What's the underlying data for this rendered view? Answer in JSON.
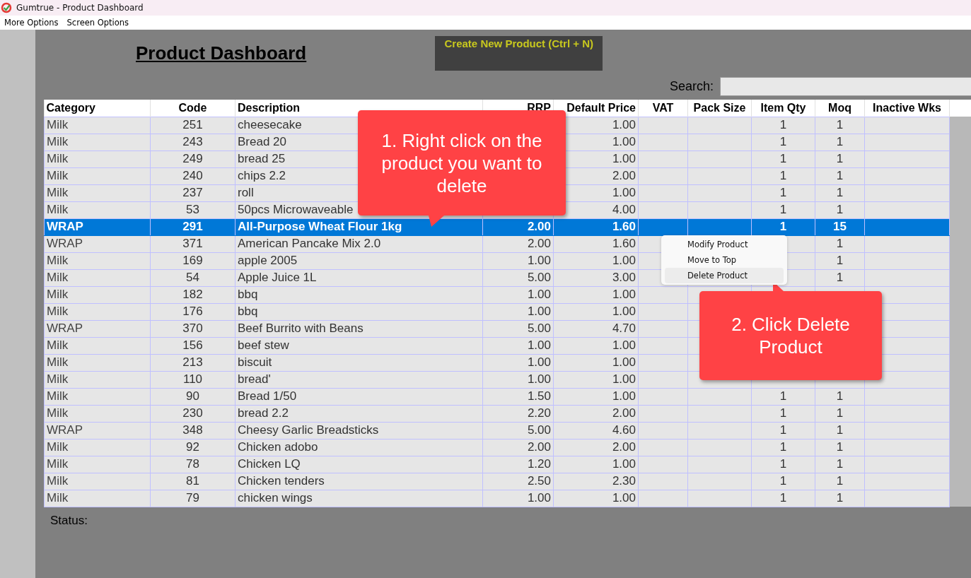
{
  "window": {
    "title": "Gumtrue - Product Dashboard"
  },
  "menu": [
    "More Options",
    "Screen Options"
  ],
  "heading": "Product Dashboard",
  "create_button": "Create New Product (Ctrl + N)",
  "search": {
    "label": "Search:"
  },
  "table": {
    "columns": [
      "Category",
      "Code",
      "Description",
      "RRP",
      "Default Price",
      "VAT",
      "Pack Size",
      "Item Qty",
      "Moq",
      "Inactive Wks"
    ],
    "rows": [
      {
        "category": "Milk",
        "code": "251",
        "description": "cheesecake",
        "default_price": "1.00",
        "item_qty": "1",
        "moq": "1",
        "selected": false
      },
      {
        "category": "Milk",
        "code": "243",
        "description": "Bread 20",
        "default_price": "1.00",
        "item_qty": "1",
        "moq": "1",
        "selected": false
      },
      {
        "category": "Milk",
        "code": "249",
        "description": "bread 25",
        "default_price": "1.00",
        "item_qty": "1",
        "moq": "1",
        "selected": false
      },
      {
        "category": "Milk",
        "code": "240",
        "description": "chips 2.2",
        "default_price": "2.00",
        "item_qty": "1",
        "moq": "1",
        "selected": false
      },
      {
        "category": "Milk",
        "code": "237",
        "description": "roll",
        "default_price": "1.00",
        "item_qty": "1",
        "moq": "1",
        "selected": false
      },
      {
        "category": "Milk",
        "code": "53",
        "description": "50pcs Microwaveable",
        "default_price": "4.00",
        "item_qty": "1",
        "moq": "1",
        "selected": false
      },
      {
        "category": "WRAP",
        "code": "291",
        "description": "All-Purpose Wheat Flour 1kg",
        "rrp": "2.00",
        "default_price": "1.60",
        "item_qty": "1",
        "moq": "15",
        "selected": true
      },
      {
        "category": "WRAP",
        "code": "371",
        "description": "American Pancake Mix 2.0",
        "rrp": "2.00",
        "default_price": "1.60",
        "moq": "1",
        "selected": false
      },
      {
        "category": "Milk",
        "code": "169",
        "description": "apple 2005",
        "rrp": "1.00",
        "default_price": "1.00",
        "moq": "1",
        "selected": false
      },
      {
        "category": "Milk",
        "code": "54",
        "description": "Apple Juice 1L",
        "rrp": "5.00",
        "default_price": "3.00",
        "moq": "1",
        "selected": false
      },
      {
        "category": "Milk",
        "code": "182",
        "description": "bbq",
        "rrp": "1.00",
        "default_price": "1.00",
        "selected": false
      },
      {
        "category": "Milk",
        "code": "176",
        "description": "bbq",
        "rrp": "1.00",
        "default_price": "1.00",
        "selected": false
      },
      {
        "category": "WRAP",
        "code": "370",
        "description": "Beef Burrito with Beans",
        "rrp": "5.00",
        "default_price": "4.70",
        "selected": false
      },
      {
        "category": "Milk",
        "code": "156",
        "description": "beef stew",
        "rrp": "1.00",
        "default_price": "1.00",
        "selected": false
      },
      {
        "category": "Milk",
        "code": "213",
        "description": "biscuit",
        "rrp": "1.00",
        "default_price": "1.00",
        "selected": false
      },
      {
        "category": "Milk",
        "code": "110",
        "description": "bread'",
        "rrp": "1.00",
        "default_price": "1.00",
        "selected": false
      },
      {
        "category": "Milk",
        "code": "90",
        "description": "Bread 1/50",
        "rrp": "1.50",
        "default_price": "1.00",
        "item_qty": "1",
        "moq": "1",
        "selected": false
      },
      {
        "category": "Milk",
        "code": "230",
        "description": "bread 2.2",
        "rrp": "2.20",
        "default_price": "2.00",
        "item_qty": "1",
        "moq": "1",
        "selected": false
      },
      {
        "category": "WRAP",
        "code": "348",
        "description": "Cheesy Garlic Breadsticks",
        "rrp": "5.00",
        "default_price": "4.60",
        "item_qty": "1",
        "moq": "1",
        "selected": false
      },
      {
        "category": "Milk",
        "code": "92",
        "description": "Chicken adobo",
        "rrp": "2.00",
        "default_price": "2.00",
        "item_qty": "1",
        "moq": "1",
        "selected": false
      },
      {
        "category": "Milk",
        "code": "78",
        "description": "Chicken LQ",
        "rrp": "1.20",
        "default_price": "1.00",
        "item_qty": "1",
        "moq": "1",
        "selected": false
      },
      {
        "category": "Milk",
        "code": "81",
        "description": "Chicken tenders",
        "rrp": "2.50",
        "default_price": "2.30",
        "item_qty": "1",
        "moq": "1",
        "selected": false
      },
      {
        "category": "Milk",
        "code": "79",
        "description": "chicken wings",
        "rrp": "1.00",
        "default_price": "1.00",
        "item_qty": "1",
        "moq": "1",
        "selected": false
      }
    ]
  },
  "context_menu": [
    {
      "label": "Modify Product",
      "selected": false
    },
    {
      "label": "Move to Top",
      "selected": false
    },
    {
      "label": "Delete Product",
      "selected": true
    }
  ],
  "callouts": [
    "1. Right click on the product you want to delete",
    "2. Click Delete Product"
  ],
  "status": {
    "label": "Status:"
  }
}
